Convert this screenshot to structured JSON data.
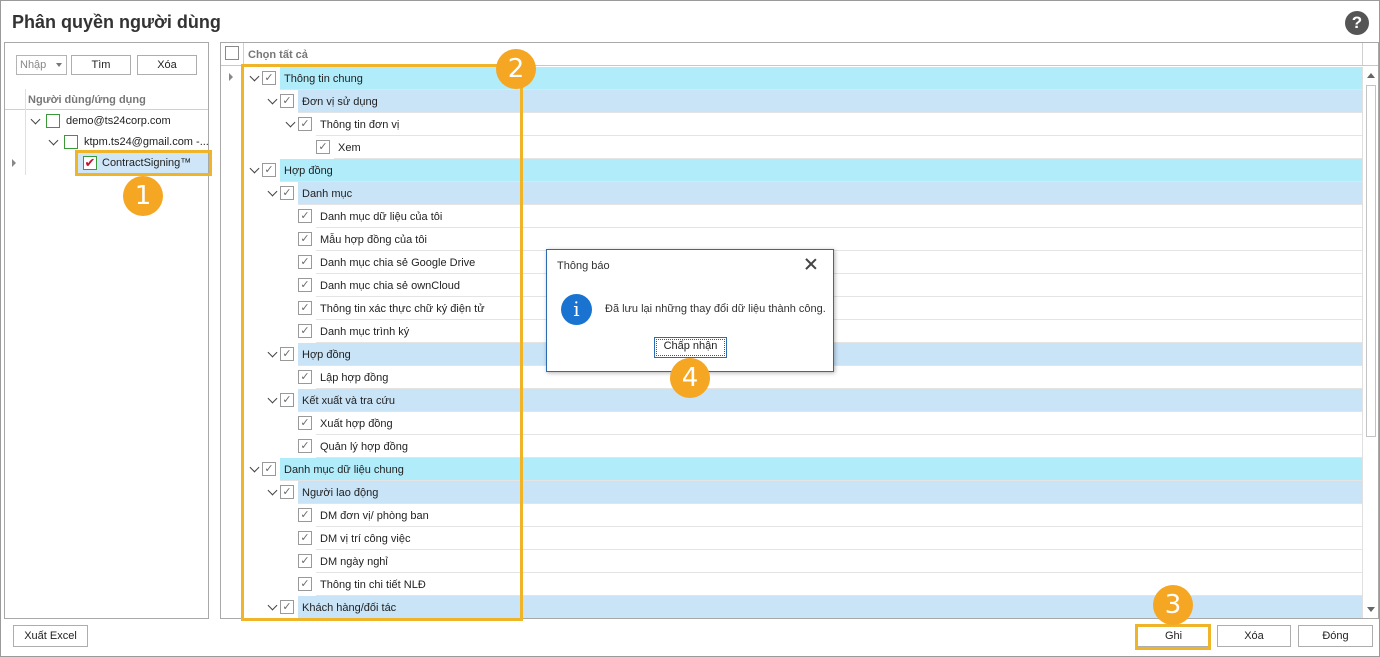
{
  "window": {
    "title": "Phân quyền người dùng"
  },
  "left_panel": {
    "combo_value": "Nhập",
    "find_label": "Tìm",
    "delete_label": "Xóa",
    "column_header": "Người dùng/ứng dụng",
    "tree": [
      {
        "label": "demo@ts24corp.com",
        "level": 0
      },
      {
        "label": "ktpm.ts24@gmail.com -...",
        "level": 1
      },
      {
        "label": "ContractSigning™",
        "level": 2,
        "checked": true
      }
    ]
  },
  "grid": {
    "header_label": "Chọn tất cả",
    "rows": [
      {
        "label": "Thông tin chung",
        "level": 0,
        "checked": true,
        "expandable": true
      },
      {
        "label": "Đơn vị sử dụng",
        "level": 1,
        "checked": true,
        "expandable": true
      },
      {
        "label": "Thông tin đơn vị",
        "level": 2,
        "checked": true,
        "expandable": true
      },
      {
        "label": "Xem",
        "level": 3,
        "checked": true,
        "expandable": false
      },
      {
        "label": "Hợp đồng",
        "level": 0,
        "checked": true,
        "expandable": true
      },
      {
        "label": "Danh mục",
        "level": 1,
        "checked": true,
        "expandable": true
      },
      {
        "label": "Danh mục dữ liệu của tôi",
        "level": 2,
        "checked": true,
        "expandable": false
      },
      {
        "label": "Mẫu hợp đồng của tôi",
        "level": 2,
        "checked": true,
        "expandable": false
      },
      {
        "label": "Danh mục chia sẻ Google Drive",
        "level": 2,
        "checked": true,
        "expandable": false
      },
      {
        "label": "Danh mục chia sẻ ownCloud",
        "level": 2,
        "checked": true,
        "expandable": false
      },
      {
        "label": "Thông tin xác thực chữ ký điện tử",
        "level": 2,
        "checked": true,
        "expandable": false
      },
      {
        "label": "Danh mục trình ký",
        "level": 2,
        "checked": true,
        "expandable": false
      },
      {
        "label": "Hợp đồng",
        "level": 1,
        "checked": true,
        "expandable": true
      },
      {
        "label": "Lập hợp đồng",
        "level": 2,
        "checked": true,
        "expandable": false
      },
      {
        "label": "Kết xuất và tra cứu",
        "level": 1,
        "checked": true,
        "expandable": true
      },
      {
        "label": "Xuất hợp đồng",
        "level": 2,
        "checked": true,
        "expandable": false
      },
      {
        "label": "Quản lý hợp đồng",
        "level": 2,
        "checked": true,
        "expandable": false
      },
      {
        "label": "Danh mục dữ liệu chung",
        "level": 0,
        "checked": true,
        "expandable": true
      },
      {
        "label": "Người lao động",
        "level": 1,
        "checked": true,
        "expandable": true
      },
      {
        "label": "DM đơn vị/ phòng ban",
        "level": 2,
        "checked": true,
        "expandable": false
      },
      {
        "label": "DM vị trí công việc",
        "level": 2,
        "checked": true,
        "expandable": false
      },
      {
        "label": "DM ngày nghỉ",
        "level": 2,
        "checked": true,
        "expandable": false
      },
      {
        "label": "Thông tin chi tiết NLĐ",
        "level": 2,
        "checked": true,
        "expandable": false
      },
      {
        "label": "Khách hàng/đối tác",
        "level": 1,
        "checked": true,
        "expandable": true
      }
    ]
  },
  "dialog": {
    "title": "Thông báo",
    "message": "Đã lưu lại những thay đổi dữ liệu thành công.",
    "ok_label": "Chấp nhận",
    "icon": "info-icon"
  },
  "bottom_bar": {
    "export_label": "Xuất Excel",
    "save_label": "Ghi",
    "delete_label": "Xóa",
    "close_label": "Đóng"
  },
  "callouts": [
    "1",
    "2",
    "3",
    "4"
  ],
  "colors": {
    "highlight": "#f0b429",
    "badge": "#f5a623",
    "level0_band": "#b0ecfa",
    "level1_band": "#c9e3f7",
    "info_blue": "#1a73d0"
  }
}
